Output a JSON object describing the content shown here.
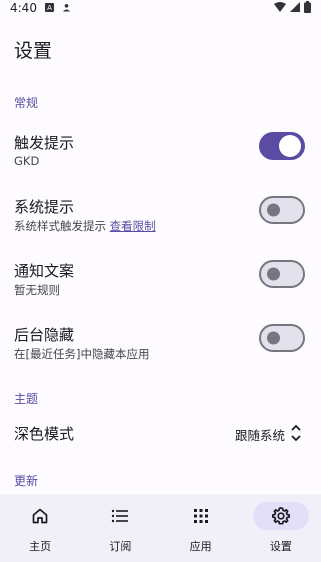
{
  "status_bar": {
    "time": "4:40",
    "icons": [
      "a-square-icon",
      "person-icon",
      "wifi-icon",
      "signal-icon",
      "battery-icon"
    ]
  },
  "page": {
    "title": "设置"
  },
  "sections": {
    "general": "常规",
    "theme": "主题",
    "update": "更新"
  },
  "settings": {
    "trigger_tip": {
      "title": "触发提示",
      "subtitle": "GKD",
      "enabled": true
    },
    "system_tip": {
      "title": "系统提示",
      "subtitle": "系统样式触发提示",
      "link": "查看限制",
      "enabled": false
    },
    "notification_text": {
      "title": "通知文案",
      "subtitle": "暂无规则",
      "enabled": false
    },
    "background_hide": {
      "title": "后台隐藏",
      "subtitle": "在[最近任务]中隐藏本应用",
      "enabled": false
    }
  },
  "dark_mode": {
    "title": "深色模式",
    "value": "跟随系统"
  },
  "nav": {
    "items": [
      {
        "label": "主页",
        "icon": "home-icon"
      },
      {
        "label": "订阅",
        "icon": "list-icon"
      },
      {
        "label": "应用",
        "icon": "apps-grid-icon"
      },
      {
        "label": "设置",
        "icon": "gear-icon"
      }
    ],
    "active": "设置"
  },
  "colors": {
    "accent": "#5b4ba3",
    "background": "#fdfbff",
    "nav_bg": "#f1eff8",
    "nav_active": "#e3dff9"
  }
}
